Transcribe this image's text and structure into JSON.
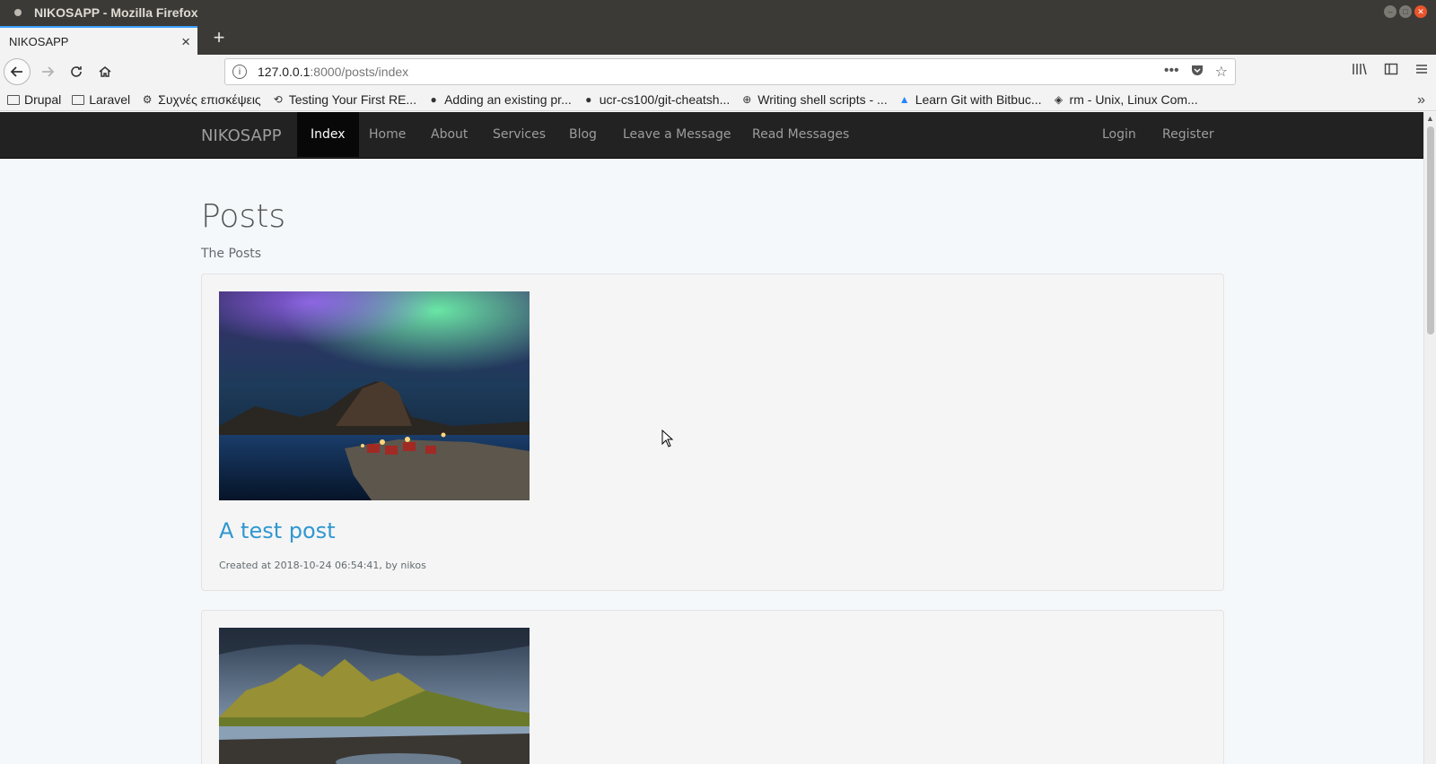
{
  "window": {
    "title": "NIKOSAPP - Mozilla Firefox"
  },
  "tabs": [
    {
      "label": "NIKOSAPP"
    }
  ],
  "address_bar": {
    "host": "127.0.0.1",
    "rest": ":8000/posts/index"
  },
  "bookmarks": [
    {
      "label": "Drupal",
      "icon": "folder-icon"
    },
    {
      "label": "Laravel",
      "icon": "folder-icon"
    },
    {
      "label": "Συχνές επισκέψεις",
      "icon": "gear-icon"
    },
    {
      "label": "Testing Your First RE...",
      "icon": "link-icon"
    },
    {
      "label": "Adding an existing pr...",
      "icon": "github-icon"
    },
    {
      "label": "ucr-cs100/git-cheatsh...",
      "icon": "github-icon"
    },
    {
      "label": "Writing shell scripts - ...",
      "icon": "globe-icon"
    },
    {
      "label": "Learn Git with Bitbuc...",
      "icon": "bitbucket-icon"
    },
    {
      "label": "rm - Unix, Linux Com...",
      "icon": "diamond-icon"
    }
  ],
  "site": {
    "brand": "NIKOSAPP",
    "nav": [
      "Index",
      "Home",
      "About",
      "Services",
      "Blog",
      "Leave a Message",
      "Read Messages"
    ],
    "auth": [
      "Login",
      "Register"
    ],
    "heading": "Posts",
    "subheading": "The Posts"
  },
  "posts": [
    {
      "title": "A test post",
      "meta": "Created at 2018-10-24 06:54:41, by nikos",
      "image": "aurora-landscape"
    },
    {
      "title": "",
      "meta": "",
      "image": "mountain-landscape"
    }
  ],
  "colors": {
    "link": "#3097d1",
    "navbar": "#222222",
    "tab_accent": "#3aa0ff"
  }
}
